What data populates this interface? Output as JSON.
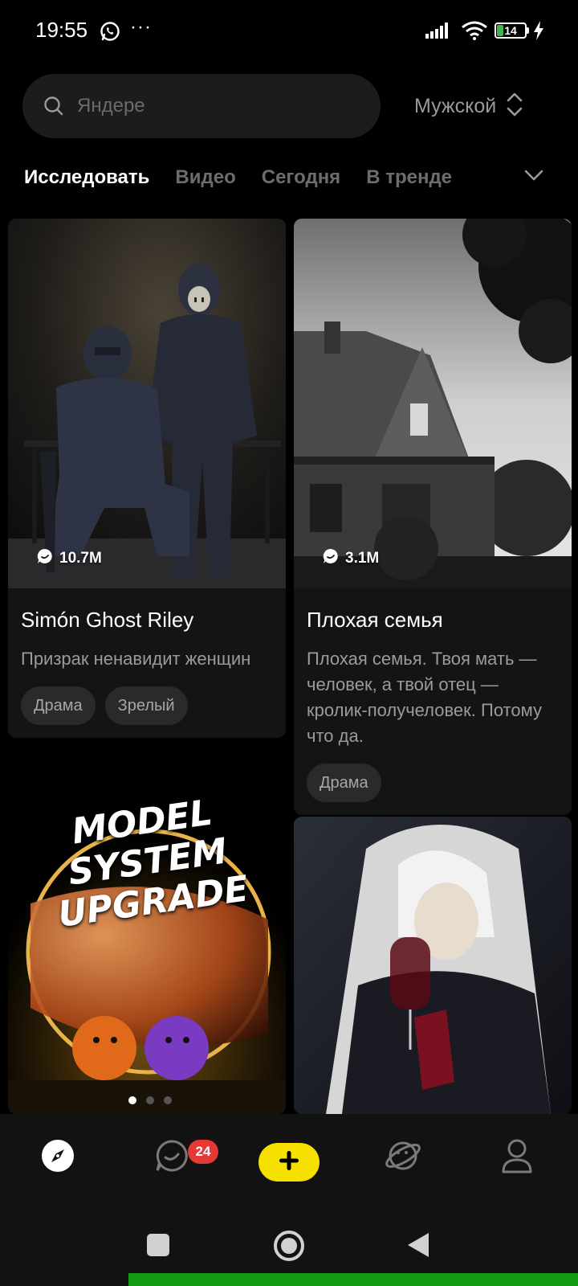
{
  "status_bar": {
    "time": "19:55",
    "more": "···",
    "battery_level": "14"
  },
  "search": {
    "placeholder": "Яндере"
  },
  "gender_select": {
    "label": "Мужской"
  },
  "tabs": [
    {
      "label": "Исследовать",
      "active": true
    },
    {
      "label": "Видео",
      "active": false
    },
    {
      "label": "Сегодня",
      "active": false
    },
    {
      "label": "В тренде",
      "active": false
    }
  ],
  "cards": [
    {
      "count": "10.7M",
      "title": "Simón Ghost Riley",
      "description": "Призрак ненавидит женщин",
      "tags": [
        "Драма",
        "Зрелый"
      ]
    },
    {
      "count": "3.1M",
      "title": "Плохая семья",
      "description": "Плохая семья. Твоя мать — человек, а твой отец — кролик-получеловек. Потому что да.",
      "tags": [
        "Драма"
      ]
    },
    {
      "banner_text_line1": "MODEL SYSTEM",
      "banner_text_line2": "UPGRADE"
    }
  ],
  "bottom_nav": {
    "chat_badge": "24",
    "items": [
      "explore-icon",
      "chat-icon",
      "add-icon",
      "planet-icon",
      "profile-icon"
    ]
  },
  "colors": {
    "accent_yellow": "#f5e000",
    "badge_red": "#e53935",
    "progress_green": "#119c12"
  }
}
